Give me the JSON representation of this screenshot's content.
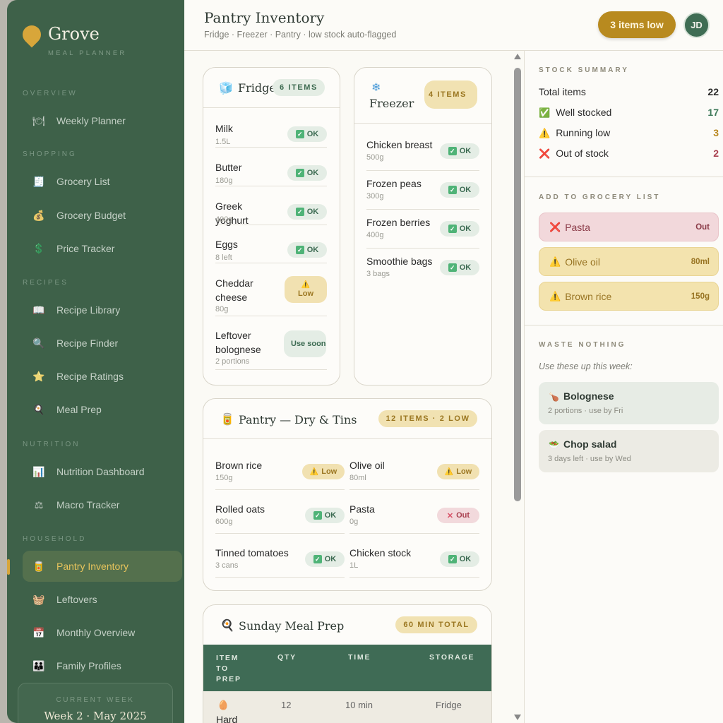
{
  "sidebar": {
    "brand": "Grove",
    "brand_sub": "MEAL PLANNER",
    "sections": [
      {
        "label": "OVERVIEW",
        "items": [
          {
            "label": "Weekly Planner",
            "icon": "🍽"
          }
        ]
      },
      {
        "label": "SHOPPING",
        "items": [
          {
            "label": "Grocery List",
            "icon": "🧾"
          },
          {
            "label": "Grocery Budget",
            "icon": "💰"
          },
          {
            "label": "Price Tracker",
            "icon": "💲"
          }
        ]
      },
      {
        "label": "RECIPES",
        "items": [
          {
            "label": "Recipe Library",
            "icon": "📖"
          },
          {
            "label": "Recipe Finder",
            "icon": "🔍"
          },
          {
            "label": "Recipe Ratings",
            "icon": "⭐"
          },
          {
            "label": "Meal Prep",
            "icon": "🍳"
          }
        ]
      },
      {
        "label": "NUTRITION",
        "items": [
          {
            "label": "Nutrition Dashboard",
            "icon": "📊"
          },
          {
            "label": "Macro Tracker",
            "icon": "⚖"
          }
        ]
      },
      {
        "label": "HOUSEHOLD",
        "items": [
          {
            "label": "Pantry Inventory",
            "icon": "🥫"
          },
          {
            "label": "Leftovers",
            "icon": "🧺"
          },
          {
            "label": "Monthly Overview",
            "icon": "📅"
          },
          {
            "label": "Family Profiles",
            "icon": "👪"
          }
        ]
      }
    ],
    "week_label": "CURRENT WEEK",
    "week_value": "Week 2 · May 2025"
  },
  "header": {
    "title": "Pantry Inventory",
    "subtitle": "Fridge · Freezer · Pantry · low stock auto-flagged",
    "low_button": "3 items low",
    "avatar": "JD"
  },
  "fridge": {
    "icon": "🧊",
    "title": "Fridge",
    "badge": "6 ITEMS",
    "items": [
      {
        "name": "Milk",
        "qty": "1.5L",
        "status": "OK"
      },
      {
        "name": "Butter",
        "qty": "180g",
        "status": "OK"
      },
      {
        "name": "Greek yoghurt",
        "qty": "400g",
        "status": "OK"
      },
      {
        "name": "Eggs",
        "qty": "8 left",
        "status": "OK"
      },
      {
        "name": "Cheddar cheese",
        "qty": "80g",
        "status": "Low"
      },
      {
        "name": "Leftover bolognese",
        "qty": "2 portions",
        "status": "Use soon"
      }
    ]
  },
  "freezer": {
    "icon": "❄",
    "title": "Freezer",
    "badge": "4 ITEMS",
    "items": [
      {
        "name": "Chicken breast",
        "qty": "500g",
        "status": "OK"
      },
      {
        "name": "Frozen peas",
        "qty": "300g",
        "status": "OK"
      },
      {
        "name": "Frozen berries",
        "qty": "400g",
        "status": "OK"
      },
      {
        "name": "Smoothie bags",
        "qty": "3 bags",
        "status": "OK"
      }
    ]
  },
  "pantry": {
    "icon": "🥫",
    "title": "Pantry — Dry & Tins",
    "badge": "12 ITEMS · 2 LOW",
    "items": [
      {
        "name": "Brown rice",
        "qty": "150g",
        "status": "Low"
      },
      {
        "name": "Olive oil",
        "qty": "80ml",
        "status": "Low"
      },
      {
        "name": "Rolled oats",
        "qty": "600g",
        "status": "OK"
      },
      {
        "name": "Pasta",
        "qty": "0g",
        "status": "Out"
      },
      {
        "name": "Tinned tomatoes",
        "qty": "3 cans",
        "status": "OK"
      },
      {
        "name": "Chicken stock",
        "qty": "1L",
        "status": "OK"
      }
    ]
  },
  "mealprep": {
    "icon": "🍳",
    "title": "Sunday Meal Prep",
    "badge": "60 MIN TOTAL",
    "columns": [
      "ITEM TO PREP",
      "QTY",
      "TIME",
      "STORAGE"
    ],
    "rows": [
      {
        "icon": "🥚",
        "item": "Hard",
        "qty": "12",
        "time": "10 min",
        "storage": "Fridge"
      }
    ]
  },
  "summary": {
    "heading": "STOCK SUMMARY",
    "rows": [
      {
        "label": "Total items",
        "value": "22",
        "color": "#2a2a2a",
        "icon": ""
      },
      {
        "label": "Well stocked",
        "value": "17",
        "color": "#3f7a5a",
        "icon": "✅"
      },
      {
        "label": "Running low",
        "value": "3",
        "color": "#b8871f",
        "icon": "⚠️"
      },
      {
        "label": "Out of stock",
        "value": "2",
        "color": "#a9404f",
        "icon": "❌"
      }
    ]
  },
  "grocery": {
    "heading": "ADD TO GROCERY LIST",
    "items": [
      {
        "icon": "❌",
        "name": "Pasta",
        "value": "Out",
        "kind": "red"
      },
      {
        "icon": "⚠️",
        "name": "Olive oil",
        "value": "80ml",
        "kind": "yel"
      },
      {
        "icon": "⚠️",
        "name": "Brown rice",
        "value": "150g",
        "kind": "yel"
      }
    ]
  },
  "waste": {
    "heading": "WASTE NOTHING",
    "note": "Use these up this week:",
    "items": [
      {
        "icon": "🍗",
        "title": "Bolognese",
        "sub": "2 portions · use by Fri"
      },
      {
        "icon": "🥗",
        "title": "Chop salad",
        "sub": "3 days left · use by Wed"
      }
    ]
  },
  "colors": {
    "sidebar": "#3e6149",
    "accent": "#d8a63a",
    "ok": "#4fb377",
    "low": "#b8871f",
    "out": "#a9404f"
  }
}
